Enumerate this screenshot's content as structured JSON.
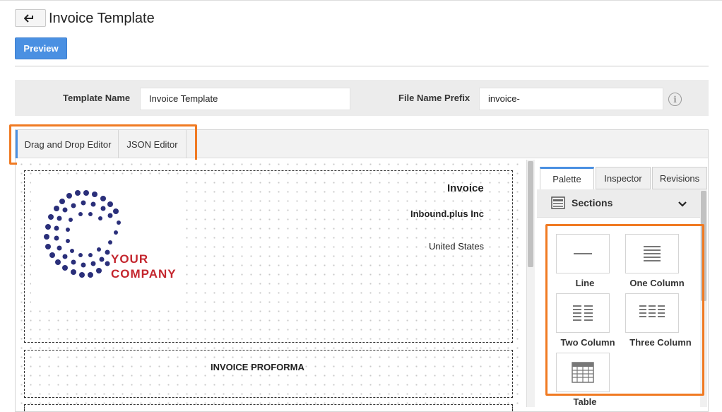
{
  "header": {
    "title": "Invoice Template",
    "preview_label": "Preview"
  },
  "form": {
    "template_name_label": "Template Name",
    "template_name_value": "Invoice Template",
    "file_prefix_label": "File Name Prefix",
    "file_prefix_value": "invoice-",
    "info_icon": "i"
  },
  "editor_tabs": [
    {
      "label": "Drag and Drop Editor",
      "active": true
    },
    {
      "label": "JSON Editor",
      "active": false
    }
  ],
  "canvas": {
    "logo": {
      "line1": "YOUR",
      "line2": "COMPANY"
    },
    "invoice_title": "Invoice",
    "company_name": "Inbound.plus Inc",
    "country": "United States",
    "proforma": "INVOICE PROFORMA"
  },
  "side_tabs": [
    {
      "label": "Palette",
      "active": true
    },
    {
      "label": "Inspector",
      "active": false
    },
    {
      "label": "Revisions",
      "active": false
    }
  ],
  "palette": {
    "group_label": "Sections",
    "items": [
      {
        "label": "Line",
        "icon": "line-icon"
      },
      {
        "label": "One Column",
        "icon": "one-column-icon"
      },
      {
        "label": "Two Column",
        "icon": "two-column-icon"
      },
      {
        "label": "Three Column",
        "icon": "three-column-icon"
      },
      {
        "label": "Table",
        "icon": "table-icon"
      }
    ]
  },
  "colors": {
    "accent": "#4a90e2",
    "highlight": "#f07a22",
    "logo_navy": "#2a2f7a",
    "logo_red": "#c4262e"
  }
}
